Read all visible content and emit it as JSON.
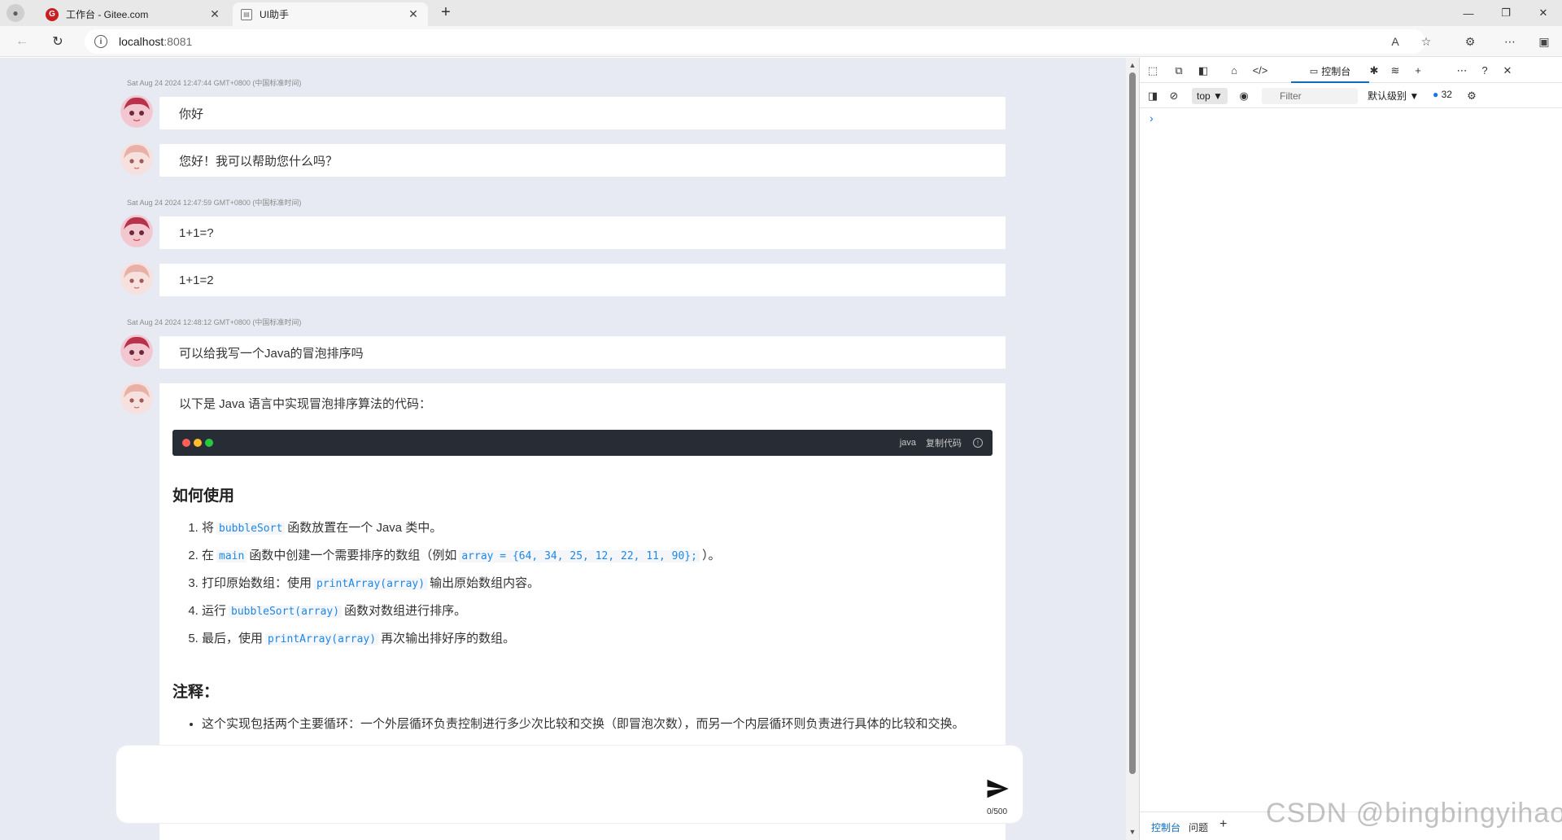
{
  "browser": {
    "tabs": [
      {
        "title": "工作台 - Gitee.com",
        "favicon": "gitee-logo"
      },
      {
        "title": "UI助手",
        "favicon": "document-icon"
      }
    ],
    "address": {
      "host": "localhost",
      "port": ":8081"
    }
  },
  "chat": {
    "messages": [
      {
        "timestamp": "Sat Aug 24 2024 12:47:44 GMT+0800 (中国标准时间)",
        "user": "你好",
        "bot": "您好！我可以帮助您什么吗？"
      },
      {
        "timestamp": "Sat Aug 24 2024 12:47:59 GMT+0800 (中国标准时间)",
        "user": "1+1=?",
        "bot": "1+1=2"
      },
      {
        "timestamp": "Sat Aug 24 2024 12:48:12 GMT+0800 (中国标准时间)",
        "user": "可以给我写一个Java的冒泡排序吗"
      }
    ],
    "answer": {
      "intro": "以下是 Java 语言中实现冒泡排序算法的代码：",
      "code_lang": "java",
      "copy_label": "复制代码",
      "heading_usage": "如何使用",
      "steps": [
        {
          "pre": "将",
          "code": "bubbleSort",
          "post": "函数放置在一个 Java 类中。"
        },
        {
          "pre": "在",
          "code": "main",
          "post": "函数中创建一个需要排序的数组（例如",
          "code2": "array = {64, 34, 25, 12, 22, 11, 90};",
          "post2": "）。"
        },
        {
          "pre": "打印原始数组：使用",
          "code": "printArray(array)",
          "post": "输出原始数组内容。"
        },
        {
          "pre": "运行",
          "code": "bubbleSort(array)",
          "post": "函数对数组进行排序。"
        },
        {
          "pre": "最后，使用",
          "code": "printArray(array)",
          "post": "再次输出排好序的数组。"
        }
      ],
      "heading_notes": "注释：",
      "notes": [
        "这个实现包括两个主要循环：一个外层循环负责控制进行多少次比较和交换（即冒泡次数），而另一个内层循环则负责进行具体的比较和交换。"
      ]
    },
    "input": {
      "value": "",
      "counter": "0/500"
    }
  },
  "devtools": {
    "active_tab": "控制台",
    "context": "top",
    "filter_placeholder": "Filter",
    "level": "默认级别",
    "issue_count": "32",
    "bottom_tabs": [
      "控制台",
      "问题"
    ]
  },
  "watermark": "CSDN @bingbingyihao",
  "colors": {
    "page_bg": "#e8eaf3",
    "accent": "#0f6cbd",
    "code_text": "#1e88e5",
    "code_bar": "#282c34"
  }
}
